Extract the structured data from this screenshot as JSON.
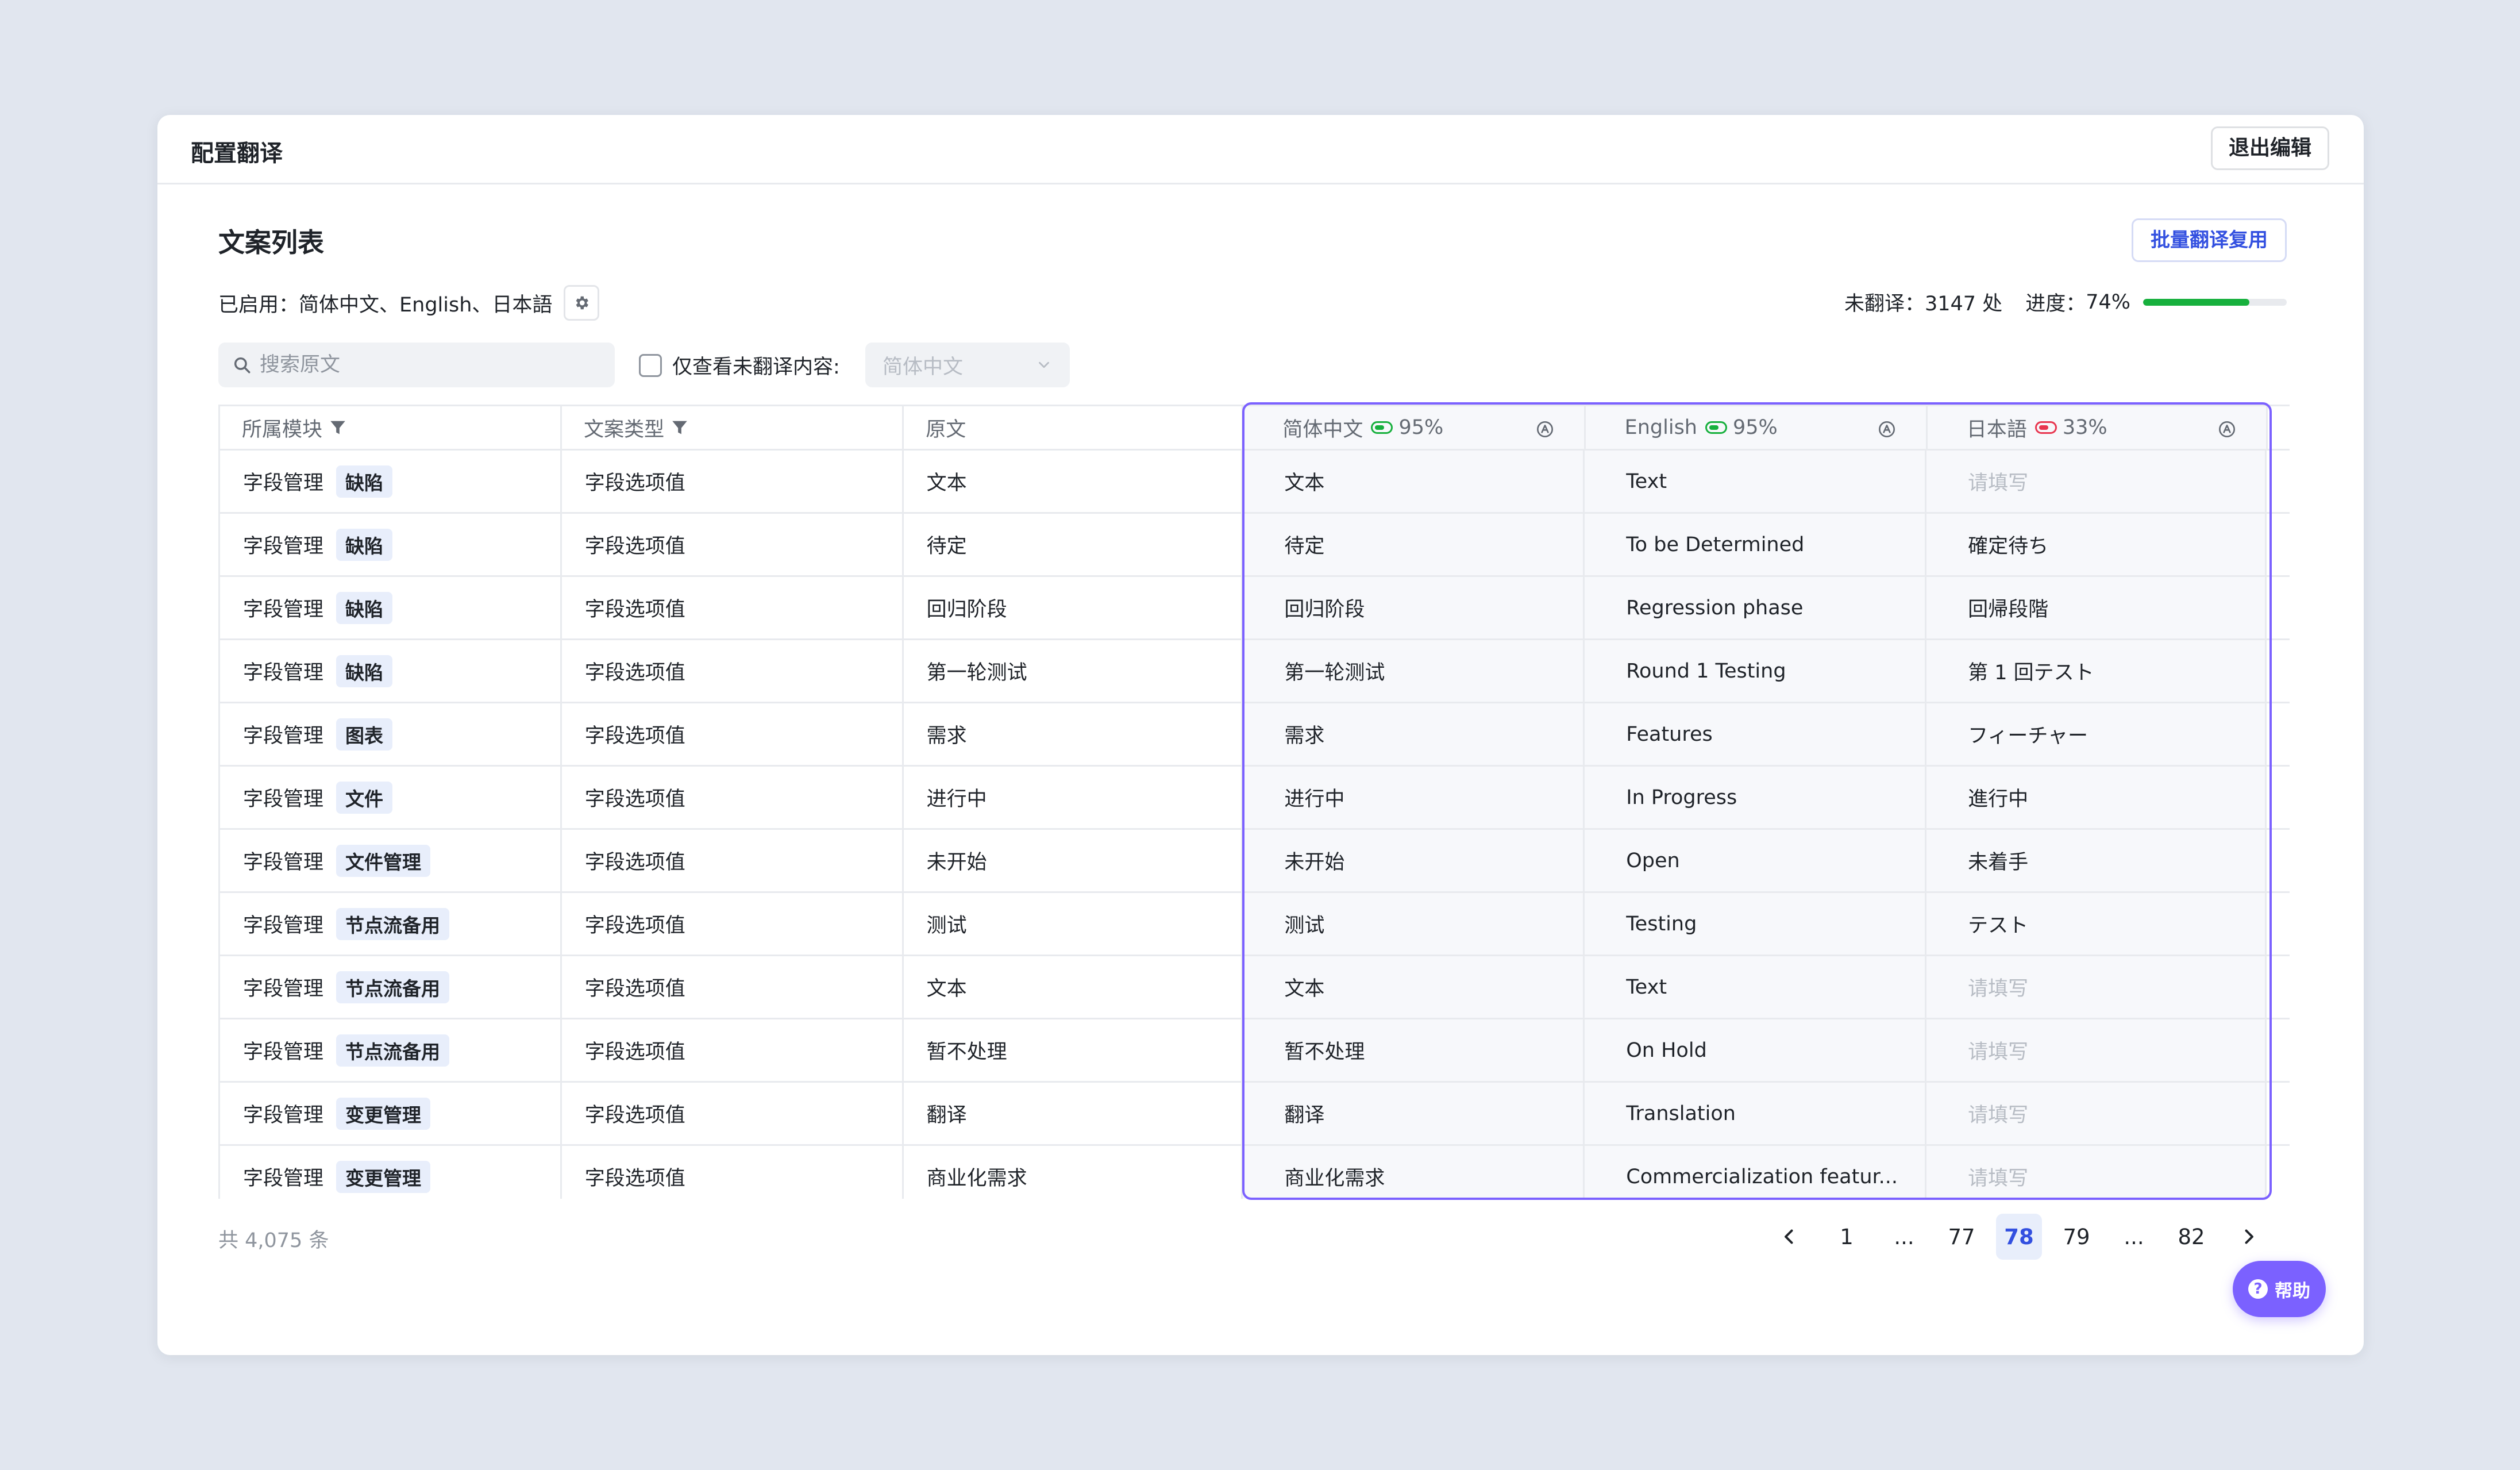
{
  "window": {
    "title": "配置翻译",
    "exit_label": "退出编辑"
  },
  "section": {
    "title": "文案列表",
    "batch_label": "批量翻译复用"
  },
  "enabled": {
    "label": "已启用：",
    "languages": "简体中文、English、日本語"
  },
  "progress": {
    "untranslated_label": "未翻译：",
    "untranslated_value": "3147 处",
    "progress_label": "进度：",
    "progress_value": "74%",
    "fraction": 0.74,
    "color": "#17b03d"
  },
  "filters": {
    "search_placeholder": "搜索原文",
    "only_untranslated_label": "仅查看未翻译内容:",
    "language_select": "简体中文"
  },
  "columns": {
    "module": "所属模块",
    "type": "文案类型",
    "source": "原文",
    "langs": [
      {
        "name": "简体中文",
        "pct": "95%",
        "status_color": "#17b03d"
      },
      {
        "name": "English",
        "pct": "95%",
        "status_color": "#17b03d"
      },
      {
        "name": "日本語",
        "pct": "33%",
        "status_color": "#e8364f"
      }
    ]
  },
  "rows": [
    {
      "module": "字段管理",
      "tag": "缺陷",
      "type": "字段选项值",
      "source": "文本",
      "zh": "文本",
      "en": "Text",
      "ja": "请填写",
      "ja_placeholder": true
    },
    {
      "module": "字段管理",
      "tag": "缺陷",
      "type": "字段选项值",
      "source": "待定",
      "zh": "待定",
      "en": "To be Determined",
      "ja": "確定待ち",
      "ja_placeholder": false
    },
    {
      "module": "字段管理",
      "tag": "缺陷",
      "type": "字段选项值",
      "source": "回归阶段",
      "zh": "回归阶段",
      "en": "Regression phase",
      "ja": "回帰段階",
      "ja_placeholder": false
    },
    {
      "module": "字段管理",
      "tag": "缺陷",
      "type": "字段选项值",
      "source": "第一轮测试",
      "zh": "第一轮测试",
      "en": "Round 1 Testing",
      "ja": "第 1 回テスト",
      "ja_placeholder": false
    },
    {
      "module": "字段管理",
      "tag": "图表",
      "type": "字段选项值",
      "source": "需求",
      "zh": "需求",
      "en": "Features",
      "ja": "フィーチャー",
      "ja_placeholder": false
    },
    {
      "module": "字段管理",
      "tag": "文件",
      "type": "字段选项值",
      "source": "进行中",
      "zh": "进行中",
      "en": "In Progress",
      "ja": "進行中",
      "ja_placeholder": false
    },
    {
      "module": "字段管理",
      "tag": "文件管理",
      "type": "字段选项值",
      "source": "未开始",
      "zh": "未开始",
      "en": "Open",
      "ja": "未着手",
      "ja_placeholder": false
    },
    {
      "module": "字段管理",
      "tag": "节点流备用",
      "type": "字段选项值",
      "source": "测试",
      "zh": "测试",
      "en": "Testing",
      "ja": "テスト",
      "ja_placeholder": false
    },
    {
      "module": "字段管理",
      "tag": "节点流备用",
      "type": "字段选项值",
      "source": "文本",
      "zh": "文本",
      "en": "Text",
      "ja": "请填写",
      "ja_placeholder": true
    },
    {
      "module": "字段管理",
      "tag": "节点流备用",
      "type": "字段选项值",
      "source": "暂不处理",
      "zh": "暂不处理",
      "en": "On Hold",
      "ja": "请填写",
      "ja_placeholder": true
    },
    {
      "module": "字段管理",
      "tag": "变更管理",
      "type": "字段选项值",
      "source": "翻译",
      "zh": "翻译",
      "en": "Translation",
      "ja": "请填写",
      "ja_placeholder": true
    },
    {
      "module": "字段管理",
      "tag": "变更管理",
      "type": "字段选项值",
      "source": "商业化需求",
      "zh": "商业化需求",
      "en": "Commercialization featur...",
      "ja": "请填写",
      "ja_placeholder": true
    }
  ],
  "footer": {
    "total": "共 4,075 条",
    "pages": [
      "1",
      "...",
      "77",
      "78",
      "79",
      "...",
      "82"
    ],
    "active_page": "78"
  },
  "help": {
    "label": "帮助",
    "icon": "?"
  },
  "colors": {
    "accent": "#3350e0",
    "highlight": "#7b61ff",
    "tag_bg": "#e8eefb",
    "progress": "#17b03d"
  }
}
